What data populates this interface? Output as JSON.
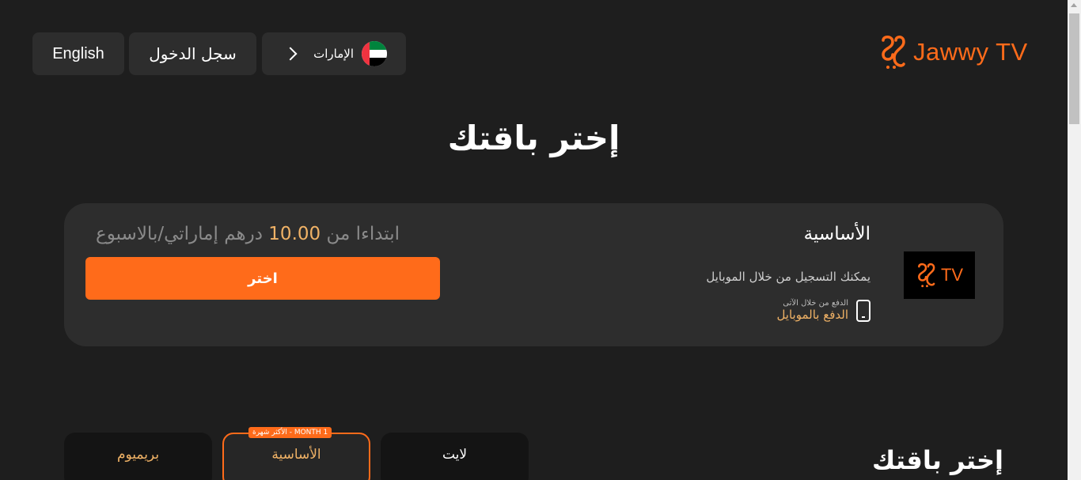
{
  "header": {
    "language_label": "English",
    "login_label": "سجل الدخول",
    "country_label": "الإمارات",
    "logo_text": "Jawwy TV"
  },
  "page_title": "إختر باقتك",
  "plan_card": {
    "logo_text": "TV",
    "name": "الأساسية",
    "description": "يمكنك التسجيل من خلال الموبايل",
    "payment_small": "الدفع من خلال الآتى",
    "payment_method": "الدفع بالموبايل",
    "price_prefix": "ابتداءا من",
    "price_amount": "10.00",
    "price_suffix": "درهم إماراتي/بالاسبوع",
    "choose_label": "اختر"
  },
  "tabs": [
    {
      "label": "بريميوم"
    },
    {
      "label": "الأساسية",
      "badge": "1 MONTH - الأكثر شهرة"
    },
    {
      "label": "لايت"
    }
  ],
  "bottom_title": "إختر باقتك",
  "colors": {
    "accent": "#ff6b1a",
    "gold": "#f0b266",
    "background": "#1e1e1e",
    "card": "#2d2d2d"
  }
}
